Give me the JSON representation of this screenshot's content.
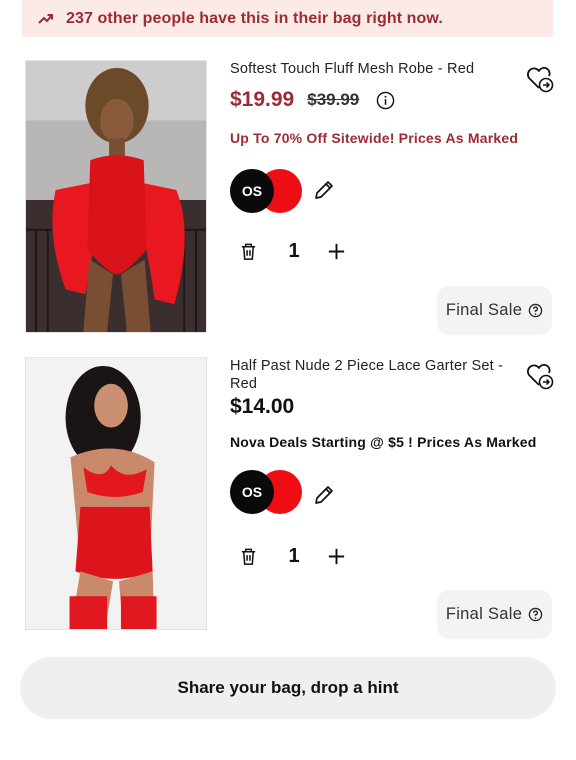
{
  "banner": {
    "text": "237 other people have this in their bag right now.",
    "icon": "trending-up-icon"
  },
  "items": [
    {
      "name": "Softest Touch Fluff Mesh Robe - Red",
      "price": "$19.99",
      "original_price": "$39.99",
      "promo": "Up To 70% Off Sitewide! Prices As Marked",
      "size": "OS",
      "color": "#ef0d14",
      "quantity": "1",
      "final_sale": "Final Sale"
    },
    {
      "name": "Half Past Nude 2 Piece Lace Garter Set - Red",
      "price": "$14.00",
      "promo": "Nova Deals Starting @ $5 ! Prices As Marked",
      "size": "OS",
      "color": "#ef0d14",
      "quantity": "1",
      "final_sale": "Final Sale"
    }
  ],
  "share_button": "Share your bag, drop a hint",
  "colors": {
    "accent": "#9d2b36",
    "banner_bg": "#fbeae6",
    "pill_bg": "#f4f3f1"
  }
}
